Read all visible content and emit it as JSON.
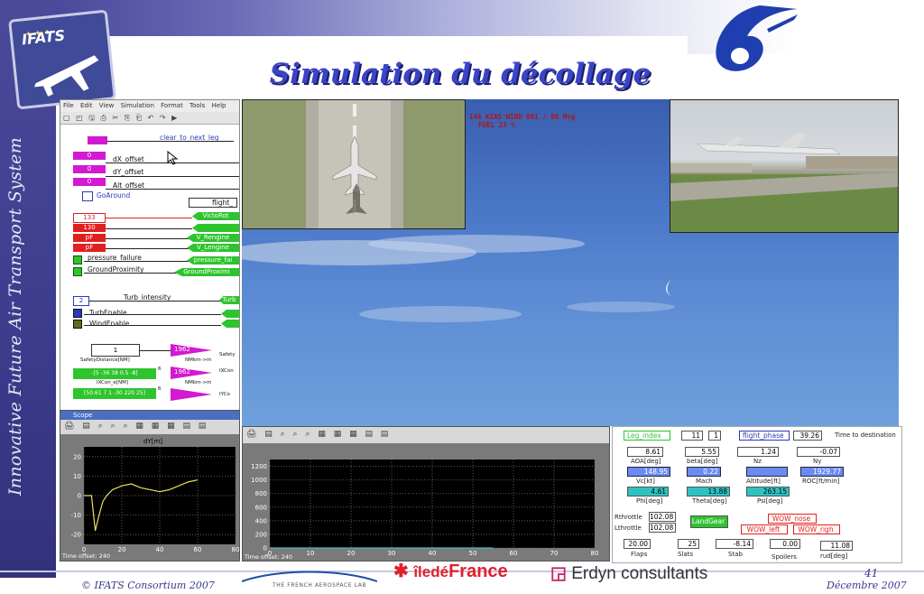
{
  "slide": {
    "title": "Simulation du décollage",
    "side_title": "Innovative Future Air Transport System",
    "logo_text": "IFATS",
    "footer_left": "© IFATS Consortium 2007",
    "footer_page": "41",
    "footer_date": "Décembre 2007",
    "partner_aero": "THE FRENCH AEROSPACE LAB",
    "partner_idf_a": "îledé",
    "partner_idf_b": "France",
    "partner_erdyn": "Erdyn consultants"
  },
  "simulink": {
    "menu": [
      "File",
      "Edit",
      "View",
      "Simulation",
      "Format",
      "Tools",
      "Help"
    ],
    "toolbar": "▢ ◰ 🖫 ⎙ ✂ ⎘ ⎗ ↶ ↷ ▶",
    "blocks": {
      "clear_leg": "clear_to_next_leg",
      "zero1": "0",
      "dx": "dX_offset",
      "zero2": "0",
      "dy": "dY_offset",
      "zero3": "0",
      "alt": "Alt_offset",
      "goaround": "GoAround",
      "flight": "flight_",
      "v133": "133",
      "v130": "130",
      "pf1": "pF",
      "pf2": "pF",
      "victoi": "VictoRot",
      "vreng": "V_Rengine",
      "vleng": "V_Lengine",
      "pressure": "pressure_failure",
      "pressure_out": "pressure_fai",
      "ground": "GroundProximity",
      "ground_out": "GroundProximi",
      "turb_val": "2",
      "turb": "Turb_intensity",
      "turb_out": "Turb",
      "turbenable": "TurbEnable",
      "windenable": "WindEnable",
      "one": "1",
      "safety_dist": "SafetyDistance[NM]",
      "safety": "Safety",
      "vec1": "-[5 -36 38 0.5 -8]",
      "ixcon": "IXCon_e[NM]",
      "vec2": "[50.61 7 1 -30 220 25]",
      "nm_km1": "NMkm->m",
      "nm_km2": "NMkm->m",
      "ixcon_out": "IXCon",
      "iycon_out": "IYCo",
      "num_1962a": "1962",
      "num_1962b": "1962",
      "six_a": "6",
      "six_b": "6"
    }
  },
  "flightsim": {
    "hud_line1": "146 KIAS  WIND 001 / 00 Msg",
    "hud_line2": "FUEL  23 %"
  },
  "scope1": {
    "window_title": "Scope",
    "toolbar": "🖨 ▤ ⌕ ⌕ ⌕ ▦ ▦ ▦ ▤ ▤",
    "plot_title": "dY[m]",
    "time_offset": "Time offset:   240",
    "y_ticks": [
      "20",
      "10",
      "0",
      "-10",
      "-20"
    ],
    "x_ticks": [
      "0",
      "20",
      "40",
      "60",
      "80"
    ]
  },
  "scope2": {
    "toolbar": "🖨 ▤ ⌕ ⌕ ⌕ ▦ ▦ ▦ ▤ ▤",
    "time_offset": "Time offset:   240",
    "y_ticks": [
      "1200",
      "1000",
      "800",
      "600",
      "400",
      "200",
      "0"
    ],
    "x_ticks": [
      "0",
      "10",
      "20",
      "30",
      "40",
      "50",
      "60",
      "70",
      "80"
    ]
  },
  "panel": {
    "leg_index": "Leg_index",
    "leg_val1": "11",
    "leg_val2": "1",
    "flight_phase": "flight_phase",
    "time_val": "39.26",
    "time_label": "Time to destination",
    "aoa_val": "8.61",
    "aoa": "AOA[deg]",
    "beta_val": "5.55",
    "beta": "beta[deg]",
    "nz_val": "1.24",
    "nz": "Nz",
    "ny_val": "-0.07",
    "ny": "Ny",
    "vc_val": "148.95",
    "vc": "Vc[kt]",
    "mach_val": "0.22",
    "mach": "Mach",
    "alt_val": "",
    "alt": "Altitude[ft]",
    "roc_val": "1929.77",
    "roc": "ROC[ft/min]",
    "phi_val": "4.61",
    "phi": "Phi[deg]",
    "theta_val": "13.88",
    "theta": "Theta[deg]",
    "psi_val": "263.15",
    "psi": "Psi[deg]",
    "rthrottle": "Rthrottle",
    "rthrottle_val": "102.08",
    "lthrottle": "Lthrottle",
    "lthrottle_val": "102.08",
    "landgear": "LandGear",
    "wow_nose": "WOW_nose",
    "wow_left": "WOW_left",
    "wow_right": "WOW_righ",
    "flaps_val": "20.00",
    "flaps": "Flaps",
    "slats_val": "25",
    "slats": "Slats",
    "stab_val": "-8.14",
    "stab": "Stab",
    "spoilers_val": "0.00",
    "spoilers": "Spoilers",
    "rud_val": "11.08",
    "rud": "rud[deg]"
  },
  "chart_data": [
    {
      "type": "line",
      "title": "dY[m]",
      "x": [
        0,
        2,
        4,
        6,
        8,
        10,
        12,
        15,
        20,
        25,
        30,
        40,
        45,
        50,
        55,
        60
      ],
      "series": [
        {
          "values": [
            0,
            0,
            0,
            -18,
            -10,
            -3,
            0,
            3,
            5,
            6,
            4,
            2,
            3,
            5,
            7,
            8
          ]
        }
      ],
      "xlim": [
        0,
        80
      ],
      "ylim": [
        -25,
        25
      ]
    },
    {
      "type": "line",
      "x": [
        0,
        55
      ],
      "series": [
        {
          "values": [
            0,
            0
          ]
        }
      ],
      "xlim": [
        0,
        80
      ],
      "ylim": [
        0,
        1300
      ]
    }
  ]
}
